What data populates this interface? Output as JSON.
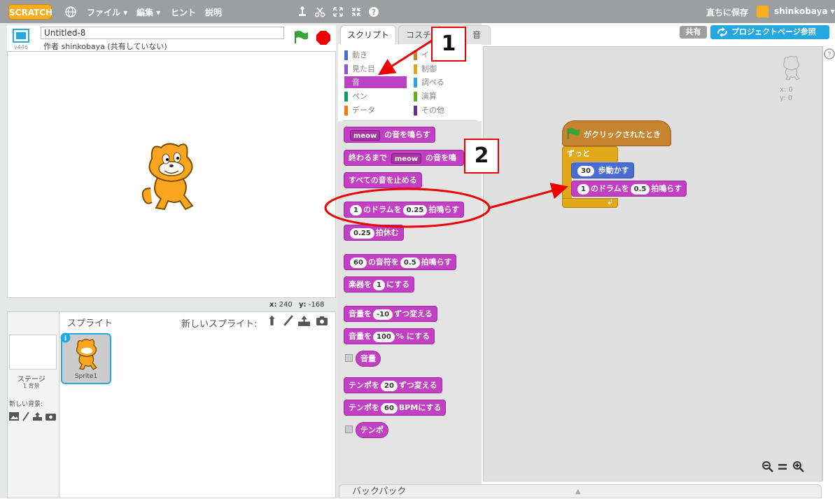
{
  "topbar": {
    "logo": "SCRATCH",
    "file_menu": "ファイル ▾",
    "edit_menu": "編集 ▾",
    "tips": "ヒント",
    "about": "説明",
    "save_now": "直ちに保存",
    "username": "shinkobaya ▾"
  },
  "stage_header": {
    "title": "Untitled-8",
    "version": "v446",
    "author": "作者 shinkobaya (共有していない)"
  },
  "stage": {
    "coords_x_label": "x:",
    "coords_x": "240",
    "coords_y_label": "y:",
    "coords_y": "-168"
  },
  "sprites_panel": {
    "title": "スプライト",
    "new_sprite_label": "新しいスプライト:",
    "stage_label": "ステージ",
    "stage_backdrops": "1 背景",
    "new_backdrop_label": "新しい背景:",
    "sprite1_name": "Sprite1"
  },
  "tabs": {
    "scripts": "スクリプト",
    "costumes": "コスチ",
    "sounds": "音"
  },
  "categories": [
    {
      "label": "動き",
      "color": "#4a6cd4"
    },
    {
      "label": "見た目",
      "color": "#8a55d7"
    },
    {
      "label": "音",
      "color": "#bb42c3"
    },
    {
      "label": "ペン",
      "color": "#0e9a6c"
    },
    {
      "label": "データ",
      "color": "#ee7d16"
    },
    {
      "label": "イ",
      "color": "#c88330"
    },
    {
      "label": "制御",
      "color": "#e1a91a"
    },
    {
      "label": "調べる",
      "color": "#2ca5e2"
    },
    {
      "label": "演算",
      "color": "#5cb712"
    },
    {
      "label": "その他",
      "color": "#632d99"
    }
  ],
  "palette": {
    "b1_val": "meow",
    "b1_text": "の音を鳴らす",
    "b2_pre": "終わるまで",
    "b2_val": "meow",
    "b2_text": "の音を鳴",
    "b3_text": "すべての音を止める",
    "b4_val1": "1",
    "b4_mid": "のドラムを",
    "b4_val2": "0.25",
    "b4_end": "拍鳴らす",
    "b5_val": "0.25",
    "b5_text": "拍休む",
    "b6_val1": "60",
    "b6_mid": "の音符を",
    "b6_val2": "0.5",
    "b6_end": "拍鳴らす",
    "b7_pre": "楽器を",
    "b7_val": "1",
    "b7_end": "にする",
    "b8_pre": "音量を",
    "b8_val": "-10",
    "b8_end": "ずつ変える",
    "b9_pre": "音量を",
    "b9_val": "100",
    "b9_end": "% にする",
    "b10_text": "音量",
    "b11_pre": "テンポを",
    "b11_val": "20",
    "b11_end": "ずつ変える",
    "b12_pre": "テンポを",
    "b12_val": "60",
    "b12_end": "BPMにする",
    "b13_text": "テンポ"
  },
  "script": {
    "hat": "がクリックされたとき",
    "forever": "ずっと",
    "move_val": "30",
    "move_text": "歩動かす",
    "drum_val1": "1",
    "drum_mid": "のドラムを",
    "drum_val2": "0.5",
    "drum_end": "拍鳴らす"
  },
  "script_area": {
    "sprite_x": "x: 0",
    "sprite_y": "y: 0",
    "help": "?"
  },
  "header_buttons": {
    "share": "共有",
    "project_page": "プロジェクトページ参照"
  },
  "backpack": "バックパック",
  "callouts": {
    "one": "1",
    "two": "2"
  }
}
